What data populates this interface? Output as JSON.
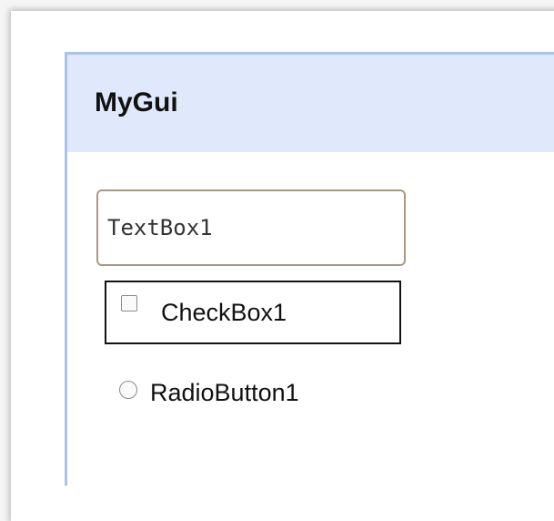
{
  "window": {
    "title": "MyGui"
  },
  "textbox": {
    "value": "TextBox1"
  },
  "checkbox": {
    "label": "CheckBox1",
    "checked": false
  },
  "radio": {
    "label": "RadioButton1",
    "selected": false
  },
  "colors": {
    "titlebar_bg": "#dfe9fb",
    "window_border": "#a9c3ea",
    "textbox_border": "#a79a85"
  }
}
